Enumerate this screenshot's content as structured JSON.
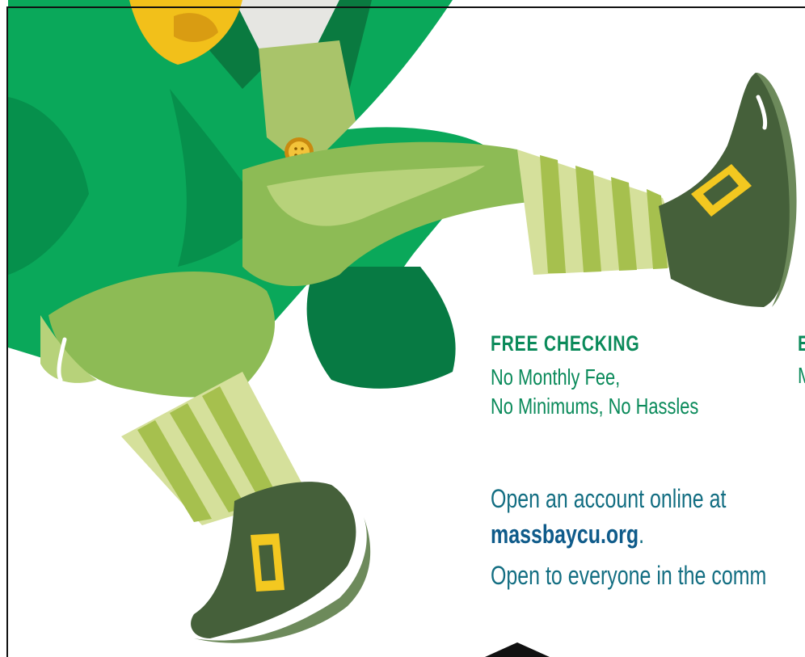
{
  "colors": {
    "green_text": "#0a8a5a",
    "teal_text": "#136e82",
    "link_blue": "#0f5b8a",
    "jacket_green": "#0aa85a",
    "pants_green": "#8dbb55",
    "boot_green": "#45603a",
    "buckle_yellow": "#f3c820"
  },
  "offers": [
    {
      "title": "FREE CHECKING",
      "line1": "No Monthly Fee,",
      "line2": "No Minimums, No Hassles"
    },
    {
      "title_fragment": "E",
      "line_fragment": "M"
    }
  ],
  "cta": {
    "line1": "Open an account online at",
    "site": "massbaycu.org",
    "period": "."
  },
  "eligibility_text_fragment": "Open to everyone in the comm",
  "illustration": {
    "subject": "dancing leprechaun in green jacket, striped stockings and buckled boots",
    "icons": [
      "button-icon",
      "buckle-icon"
    ]
  }
}
